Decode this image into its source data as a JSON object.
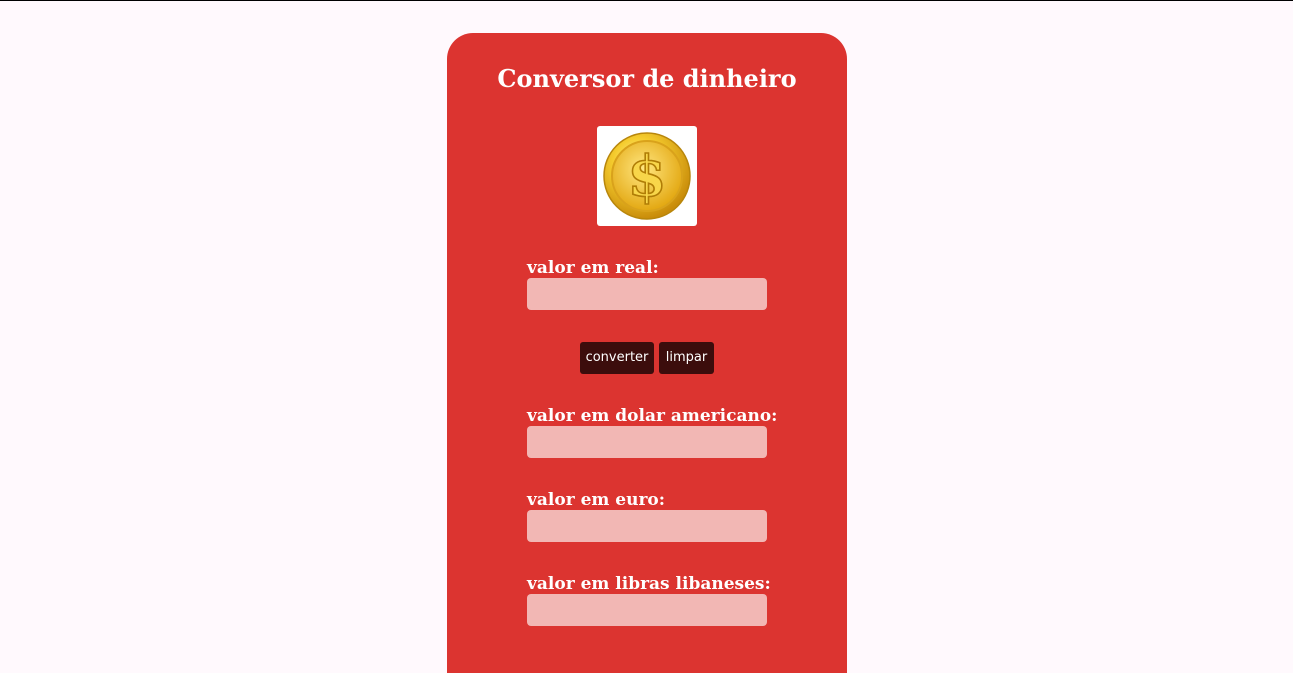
{
  "page": {
    "title": "Conversor de dinheiro",
    "logo_icon": "dollar-coin-icon"
  },
  "fields": {
    "real": {
      "label": "valor em real:",
      "value": "",
      "placeholder": ""
    },
    "dolar": {
      "label": "valor em dolar americano:",
      "value": "",
      "placeholder": ""
    },
    "euro": {
      "label": "valor em euro:",
      "value": "",
      "placeholder": ""
    },
    "libras": {
      "label": "valor em libras libaneses:",
      "value": "",
      "placeholder": ""
    }
  },
  "buttons": {
    "convert_label": "converter",
    "clear_label": "limpar"
  },
  "colors": {
    "page_background": "#fff9fd",
    "card_background": "#dc3430",
    "input_background": "#f2b7b4",
    "button_background": "#3c0d0c",
    "text": "#ffffff"
  }
}
